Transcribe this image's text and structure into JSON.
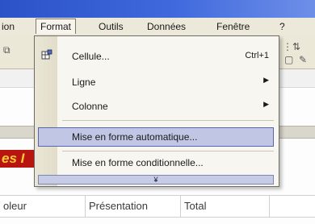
{
  "menubar": {
    "items": [
      {
        "label": "ion"
      },
      {
        "label": "Format"
      },
      {
        "label": "Outils"
      },
      {
        "label": "Données"
      },
      {
        "label": "Fenêtre"
      },
      {
        "label": "?"
      }
    ]
  },
  "format_menu": {
    "items": [
      {
        "label": "Cellule...",
        "shortcut": "Ctrl+1",
        "icon": "cell-format-icon"
      },
      {
        "label": "Ligne",
        "submenu": true
      },
      {
        "label": "Colonne",
        "submenu": true
      },
      {
        "label": "Mise en forme automatique...",
        "highlighted": true
      },
      {
        "label": "Mise en forme conditionnelle..."
      }
    ],
    "expand_glyph": "¥"
  },
  "sheet": {
    "red_cell_text": "es I",
    "row_cells": [
      "oleur",
      "Présentation",
      "Total"
    ]
  },
  "colors": {
    "title_bar": "#2c52c8",
    "menu_highlight": "#c1c6e4",
    "red_cell": "#b81410"
  }
}
